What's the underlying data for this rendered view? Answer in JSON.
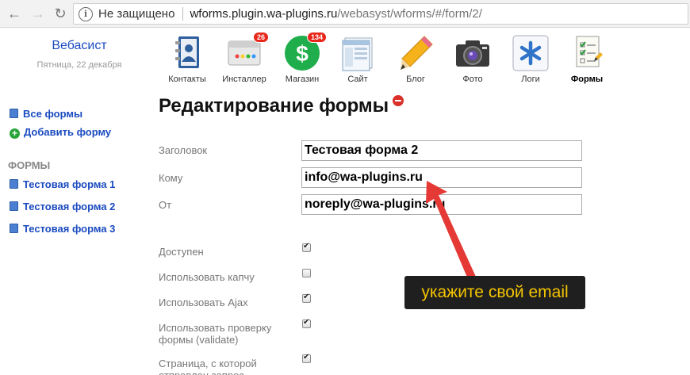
{
  "browser": {
    "not_secure": "Не защищено",
    "url_host": "wforms.plugin.wa-plugins.ru",
    "url_path": "/webasyst/wforms/#/form/2/"
  },
  "header": {
    "brand": "Вебасист",
    "date": "Пятница, 22 декабря",
    "apps": [
      {
        "label": "Контакты",
        "icon": "contacts-icon"
      },
      {
        "label": "Инсталлер",
        "icon": "installer-icon",
        "badge": "26"
      },
      {
        "label": "Магазин",
        "icon": "shop-icon",
        "badge": "134"
      },
      {
        "label": "Сайт",
        "icon": "site-icon"
      },
      {
        "label": "Блог",
        "icon": "blog-pencil-icon"
      },
      {
        "label": "Фото",
        "icon": "camera-icon"
      },
      {
        "label": "Логи",
        "icon": "logs-asterisk-icon"
      },
      {
        "label": "Формы",
        "icon": "forms-icon",
        "active": true
      }
    ]
  },
  "sidebar": {
    "all_forms": "Все формы",
    "add_form": "Добавить форму",
    "section_title": "ФОРМЫ",
    "forms": [
      "Тестовая форма 1",
      "Тестовая форма 2",
      "Тестовая форма 3"
    ]
  },
  "main": {
    "title": "Редактирование формы",
    "fields": [
      {
        "label": "Заголовок",
        "value": "Тестовая форма 2"
      },
      {
        "label": "Кому",
        "value": "info@wa-plugins.ru"
      },
      {
        "label": "От",
        "value": "noreply@wa-plugins.ru"
      }
    ],
    "options": [
      {
        "label": "Доступен",
        "checked": true
      },
      {
        "label": "Использовать капчу",
        "checked": false
      },
      {
        "label": "Использовать Ajax",
        "checked": true
      },
      {
        "label": "Использовать проверку формы (validate)",
        "checked": true
      },
      {
        "label": "Страница, с которой отправлен запрос",
        "checked": true
      }
    ]
  },
  "annotation": {
    "text": "укажите свой email",
    "color": "#e53935"
  }
}
